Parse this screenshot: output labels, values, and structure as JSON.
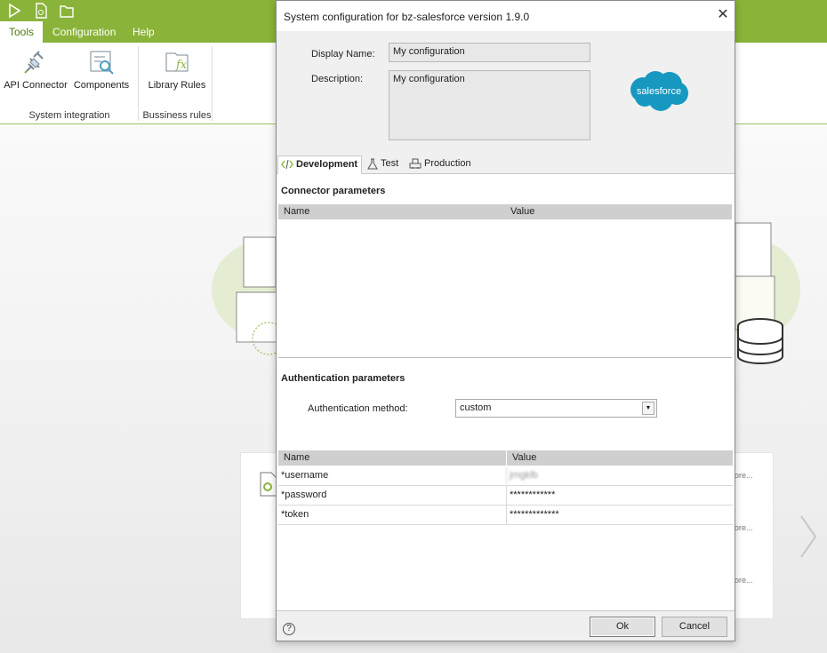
{
  "app": {
    "menu": [
      "Tools",
      "Configuration",
      "Help"
    ],
    "ribbon": {
      "buttons": [
        "API Connector",
        "Components",
        "Library Rules"
      ],
      "groups": [
        "System integration",
        "Bussiness rules"
      ]
    },
    "card_more": [
      "ore...",
      "ore...",
      "ore..."
    ]
  },
  "dialog": {
    "title": "System configuration for bz-salesforce version 1.9.0",
    "display_name_label": "Display Name:",
    "display_name_value": "My configuration",
    "description_label": "Description:",
    "description_value": "My configuration",
    "logo_text": "salesforce",
    "tabs": [
      {
        "label": "Development",
        "icon": "code-icon",
        "active": true
      },
      {
        "label": "Test",
        "icon": "flask-icon",
        "active": false
      },
      {
        "label": "Production",
        "icon": "factory-icon",
        "active": false
      }
    ],
    "connector": {
      "title": "Connector parameters",
      "col_name": "Name",
      "col_value": "Value"
    },
    "auth": {
      "title": "Authentication parameters",
      "method_label": "Authentication method:",
      "method_value": "custom",
      "col_name": "Name",
      "col_value": "Value",
      "rows": [
        {
          "name": "*username",
          "value": "jmgklb"
        },
        {
          "name": "*password",
          "value": "************"
        },
        {
          "name": "*token",
          "value": "*************"
        }
      ]
    },
    "buttons": {
      "ok": "Ok",
      "cancel": "Cancel",
      "help": "?"
    },
    "close_glyph": "✕"
  },
  "colors": {
    "accent_green": "#8ab339",
    "salesforce_blue": "#1798c1"
  }
}
